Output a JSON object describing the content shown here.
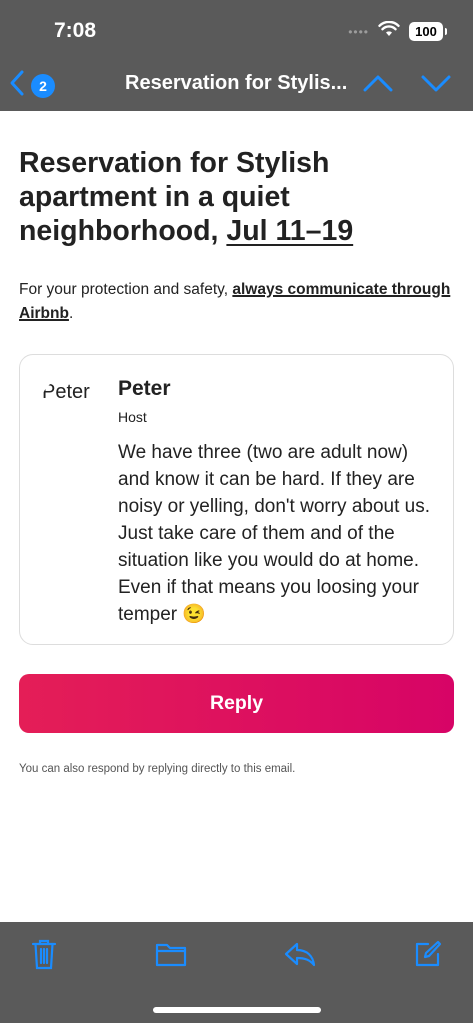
{
  "status_bar": {
    "time": "7:08",
    "signal": "••••",
    "battery": "100"
  },
  "nav": {
    "back_badge": "2",
    "title": "Reservation for Stylis...",
    "accent_color": "#1a8cff"
  },
  "email": {
    "subject_prefix": "Reservation for Stylish apartment in a quiet neighborhood, ",
    "subject_dates": "Jul 11–19",
    "safety_text": "For your protection and safety, ",
    "safety_link": "always communicate through Airbnb",
    "safety_end": ".",
    "card": {
      "avatar_text": "Peter",
      "sender_name": "Peter",
      "sender_role": "Host",
      "message": "We have three (two are adult now) and know it can be hard. If they are noisy or yelling, don't worry about us. Just take care of them and of the situation like you would do at home. Even if that means you loosing your temper 😉"
    },
    "reply_label": "Reply",
    "footnote": "You can also respond by replying directly to this email."
  },
  "toolbar": {
    "icons": [
      "trash-icon",
      "folder-icon",
      "reply-icon",
      "compose-icon"
    ]
  },
  "colors": {
    "brand_start": "#e41e57",
    "brand_end": "#d70466",
    "chrome": "#5a5a5a"
  }
}
